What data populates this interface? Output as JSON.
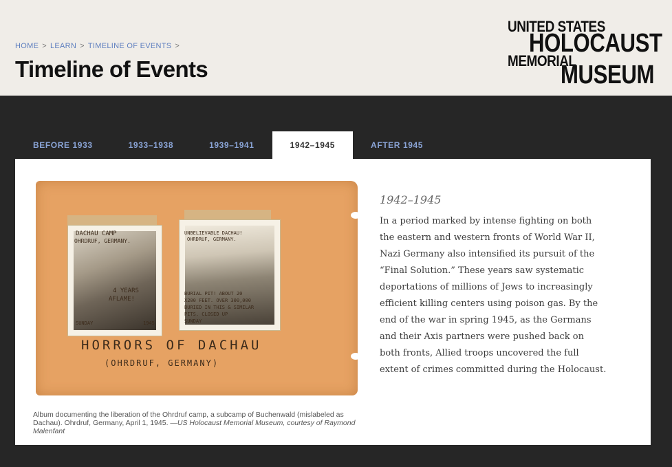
{
  "breadcrumb": {
    "items": [
      "HOME",
      "LEARN",
      "TIMELINE OF EVENTS"
    ],
    "separator": ">"
  },
  "page_title": "Timeline of Events",
  "logo": {
    "line1": "UNITED STATES",
    "line2": "HOLOCAUST",
    "line3": "MEMORIAL",
    "line4": "MUSEUM"
  },
  "tabs": [
    {
      "label": "BEFORE 1933",
      "active": false
    },
    {
      "label": "1933–1938",
      "active": false
    },
    {
      "label": "1939–1941",
      "active": false
    },
    {
      "label": "1942–1945",
      "active": true
    },
    {
      "label": "AFTER 1945",
      "active": false
    }
  ],
  "content": {
    "photo": {
      "left_snapshot_text": [
        "DACHAU CAMP",
        "OHRDRUF, GERMANY.",
        "4 YEARS",
        "AFLAME!",
        "SUNDAY",
        "1945"
      ],
      "right_snapshot_text": [
        "UNBELIEVABLE DACHAU!",
        "OHRDRUF, GERMANY.",
        "BURIAL PIT! ABOUT 20",
        "X200 FEET. OVER 300,000",
        "BURIED IN THIS & SIMILAR",
        "PITS. CLOSED UP",
        "SUNDAY"
      ],
      "album_title": "HORRORS OF DACHAU",
      "album_subtitle": "(OHRDRUF, GERMANY)"
    },
    "caption_text": "Album documenting the liberation of the Ohrdruf camp, a subcamp of Buchenwald (mislabeled as Dachau). Ohrdruf, Germany, April 1, 1945. —",
    "caption_credit": "US Holocaust Memorial Museum, courtesy of Raymond Malenfant",
    "era_title": "1942–1945",
    "description": "In a period marked by intense fighting on both the eastern and western fronts of World War II, Nazi Germany also intensified its pursuit of the “Final Solution.” These years saw systematic deportations of millions of Jews to increasingly efficient killing centers using poison gas. By the end of the war in spring 1945, as the Germans and their Axis partners were pushed back on both fronts, Allied troops uncovered the full extent of crimes committed during the Holocaust."
  },
  "colors": {
    "header_bg": "#f0ede8",
    "page_bg": "#262626",
    "link_blue": "#5e7fbf",
    "tab_blue": "#8aa4d6"
  }
}
